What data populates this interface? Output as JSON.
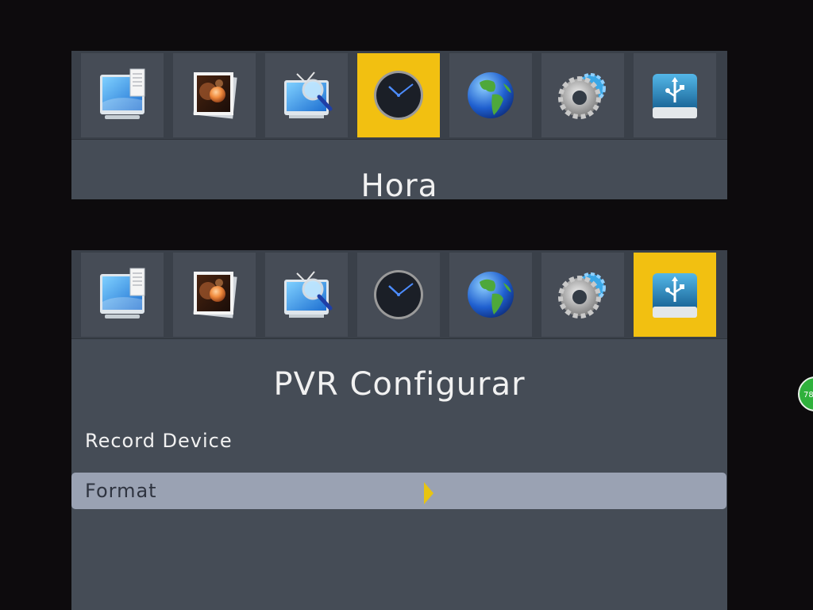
{
  "top_menu": {
    "title": "Hora",
    "selected_icon": "clock-icon",
    "icons": [
      "monitor-icon",
      "photo-icon",
      "tv-search-icon",
      "clock-icon",
      "globe-icon",
      "gear-icon",
      "usb-drive-icon"
    ]
  },
  "bottom_menu": {
    "title": "PVR Configurar",
    "selected_icon": "usb-drive-icon",
    "icons": [
      "monitor-icon",
      "photo-icon",
      "tv-search-icon",
      "clock-icon",
      "globe-icon",
      "gear-icon",
      "usb-drive-icon"
    ],
    "rows": [
      {
        "label": "Record Device"
      },
      {
        "label": "Format",
        "selected": true
      }
    ]
  },
  "side_badge": {
    "value": "78"
  },
  "colors": {
    "background": "#0d0b0d",
    "panel": "#454c56",
    "selected_tile": "#f2c011",
    "selected_row": "#9aa2b3",
    "arrow": "#e8c411",
    "badge": "#2fb13c"
  }
}
